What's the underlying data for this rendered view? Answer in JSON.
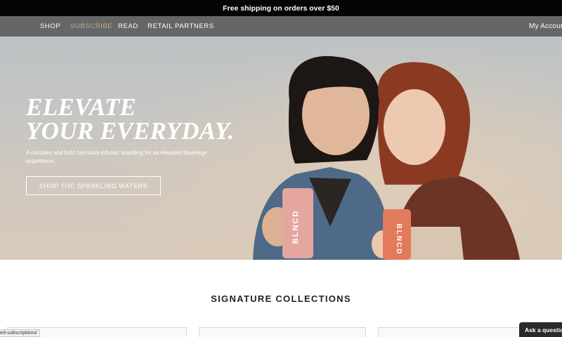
{
  "announcement": {
    "text": "Free shipping on orders over $50"
  },
  "nav": {
    "items": [
      {
        "label": "SHOP",
        "active": false
      },
      {
        "label": "SUBSCRIBE",
        "active": true
      },
      {
        "label": "READ",
        "active": false
      },
      {
        "label": "RETAIL PARTNERS",
        "active": false
      }
    ],
    "account": "My Account"
  },
  "hero": {
    "title_line1": "ELEVATE",
    "title_line2": "YOUR EVERYDAY.",
    "subtitle": "A complex and bold cannabis-infused sparkling for an elevated beverage experience.",
    "cta": "SHOP THC SPARKLING WATERS",
    "can_brand": "BLNCD"
  },
  "collections": {
    "title": "SIGNATURE COLLECTIONS"
  },
  "status_url": "ed-subscriptions/",
  "chat": {
    "label": "Ask a question"
  },
  "colors": {
    "accent": "#c8a77f",
    "announcement_bg": "#050505",
    "nav_bg": "#505254"
  }
}
